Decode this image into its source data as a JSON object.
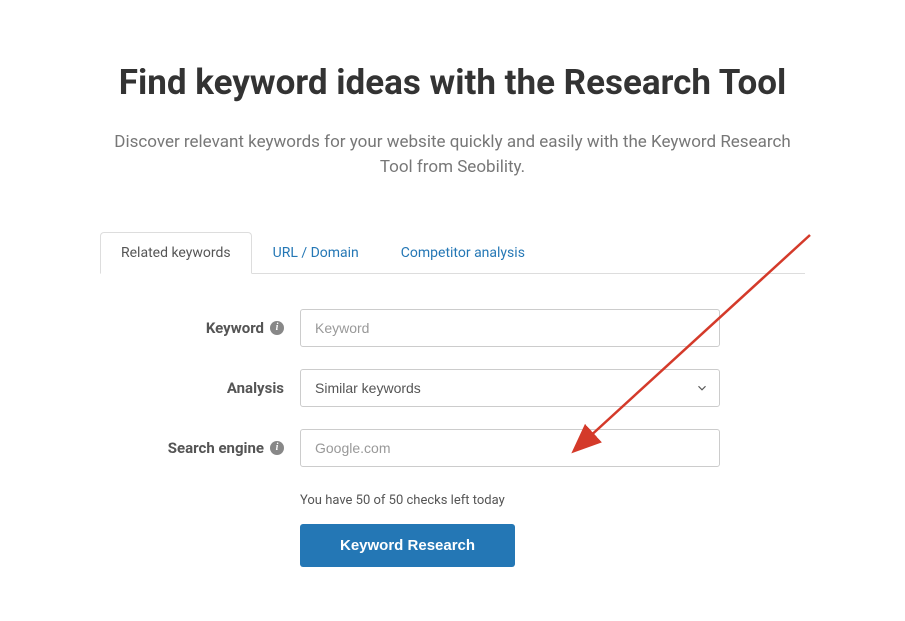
{
  "header": {
    "title": "Find keyword ideas with the Research Tool",
    "subtitle": "Discover relevant keywords for your website quickly and easily with the Keyword Research Tool from Seobility."
  },
  "tabs": [
    {
      "label": "Related keywords",
      "active": true
    },
    {
      "label": "URL / Domain",
      "active": false
    },
    {
      "label": "Competitor analysis",
      "active": false
    }
  ],
  "form": {
    "keyword": {
      "label": "Keyword",
      "placeholder": "Keyword",
      "value": ""
    },
    "analysis": {
      "label": "Analysis",
      "selected": "Similar keywords"
    },
    "search_engine": {
      "label": "Search engine",
      "placeholder": "Google.com",
      "value": ""
    }
  },
  "status": {
    "text": "You have 50 of 50 checks left today"
  },
  "actions": {
    "submit": "Keyword Research"
  }
}
